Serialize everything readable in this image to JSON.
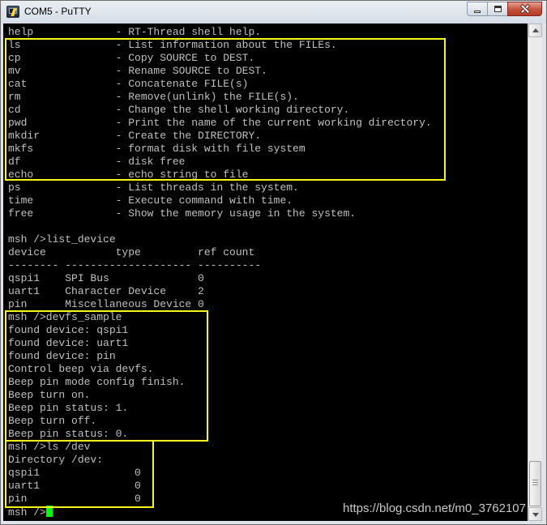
{
  "window": {
    "title": "COM5 - PuTTY",
    "icon": "putty-icon"
  },
  "controls": {
    "minimize_icon": "minimize-icon",
    "maximize_icon": "maximize-icon",
    "close_icon": "close-icon"
  },
  "terminal": {
    "background": "#000000",
    "foreground": "#c0c0c0",
    "cursor_color": "#00ff00",
    "highlight_color": "#f6f61c",
    "lines": [
      "help             - RT-Thread shell help.",
      "ls               - List information about the FILEs.",
      "cp               - Copy SOURCE to DEST.",
      "mv               - Rename SOURCE to DEST.",
      "cat              - Concatenate FILE(s)",
      "rm               - Remove(unlink) the FILE(s).",
      "cd               - Change the shell working directory.",
      "pwd              - Print the name of the current working directory.",
      "mkdir            - Create the DIRECTORY.",
      "mkfs             - format disk with file system",
      "df               - disk free",
      "echo             - echo string to file",
      "ps               - List threads in the system.",
      "time             - Execute command with time.",
      "free             - Show the memory usage in the system.",
      "",
      "msh />list_device",
      "device           type         ref count",
      "-------- -------------------- ----------",
      "qspi1    SPI Bus              0",
      "uart1    Character Device     2",
      "pin      Miscellaneous Device 0",
      "msh />devfs_sample",
      "found device: qspi1",
      "found device: uart1",
      "found device: pin",
      "Control beep via devfs.",
      "Beep pin mode config finish.",
      "Beep turn on.",
      "Beep pin status: 1.",
      "Beep turn off.",
      "Beep pin status: 0.",
      "msh />ls /dev",
      "Directory /dev:",
      "qspi1               0",
      "uart1               0",
      "pin                 0"
    ],
    "prompt": "msh />"
  },
  "watermark": "https://blog.csdn.net/m0_3762107",
  "scrollbar": {
    "up_icon": "scroll-up-arrow-icon",
    "down_icon": "scroll-down-arrow-icon"
  }
}
